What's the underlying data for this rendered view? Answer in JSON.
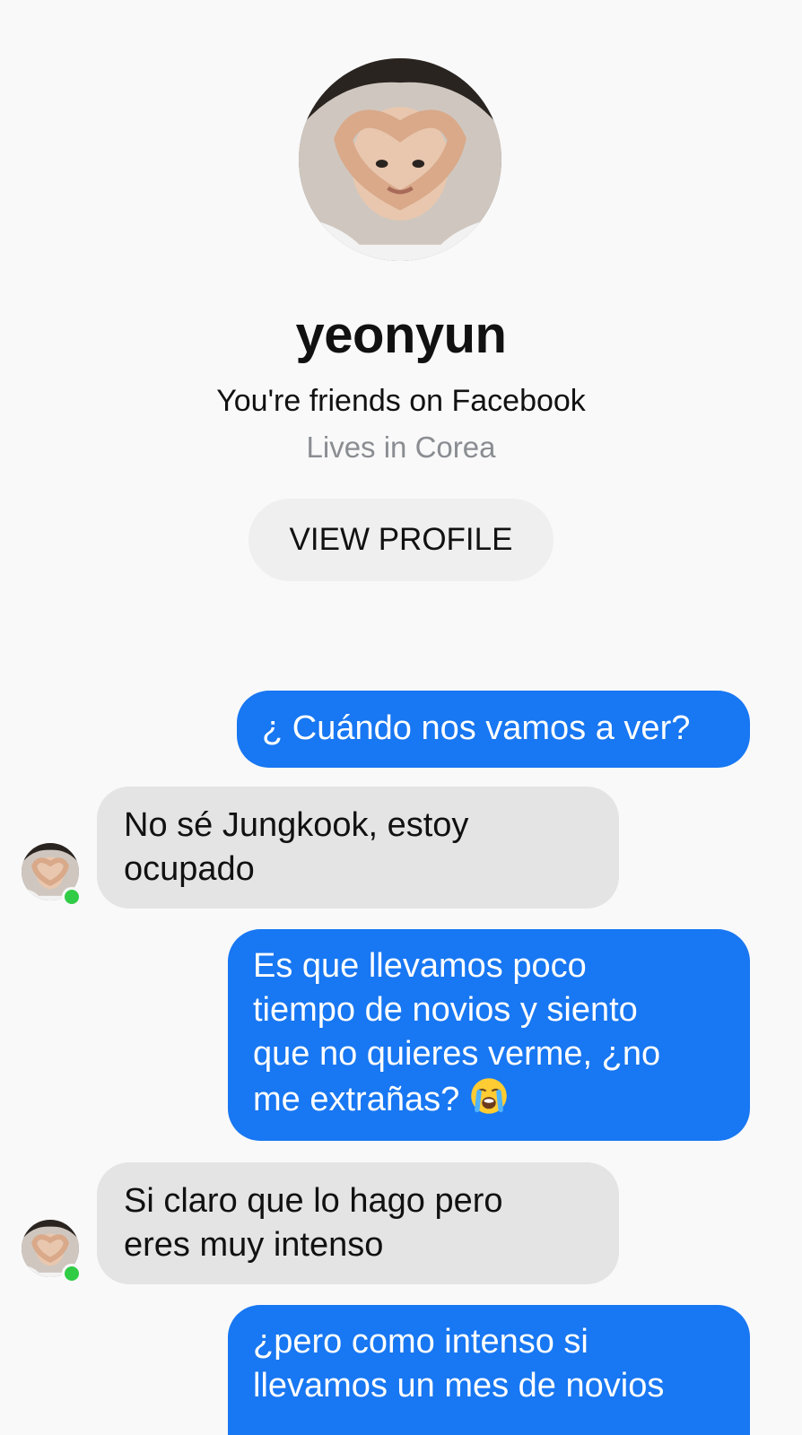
{
  "profile": {
    "name": "yeonyun",
    "friends_text": "You're friends on Facebook",
    "location_text": "Lives in Corea",
    "view_profile_label": "VIEW PROFILE"
  },
  "messages": [
    {
      "direction": "outgoing",
      "text": "¿ Cuándo nos vamos a ver?"
    },
    {
      "direction": "incoming",
      "text": "No sé Jungkook, estoy\nocupado"
    },
    {
      "direction": "outgoing",
      "text": "Es que llevamos poco\ntiempo de novios y siento\nque no quieres verme, ¿no\nme extrañas?",
      "emoji": "loudly-crying-face-icon"
    },
    {
      "direction": "incoming",
      "text": "Si claro que lo hago pero\neres muy intenso"
    },
    {
      "direction": "outgoing",
      "text": "¿pero como intenso si\nllevamos un mes de novios"
    }
  ],
  "colors": {
    "outgoing_bubble": "#1877f2",
    "incoming_bubble": "#e4e4e4",
    "online_indicator": "#31cc46",
    "background": "#f9f9fa"
  }
}
